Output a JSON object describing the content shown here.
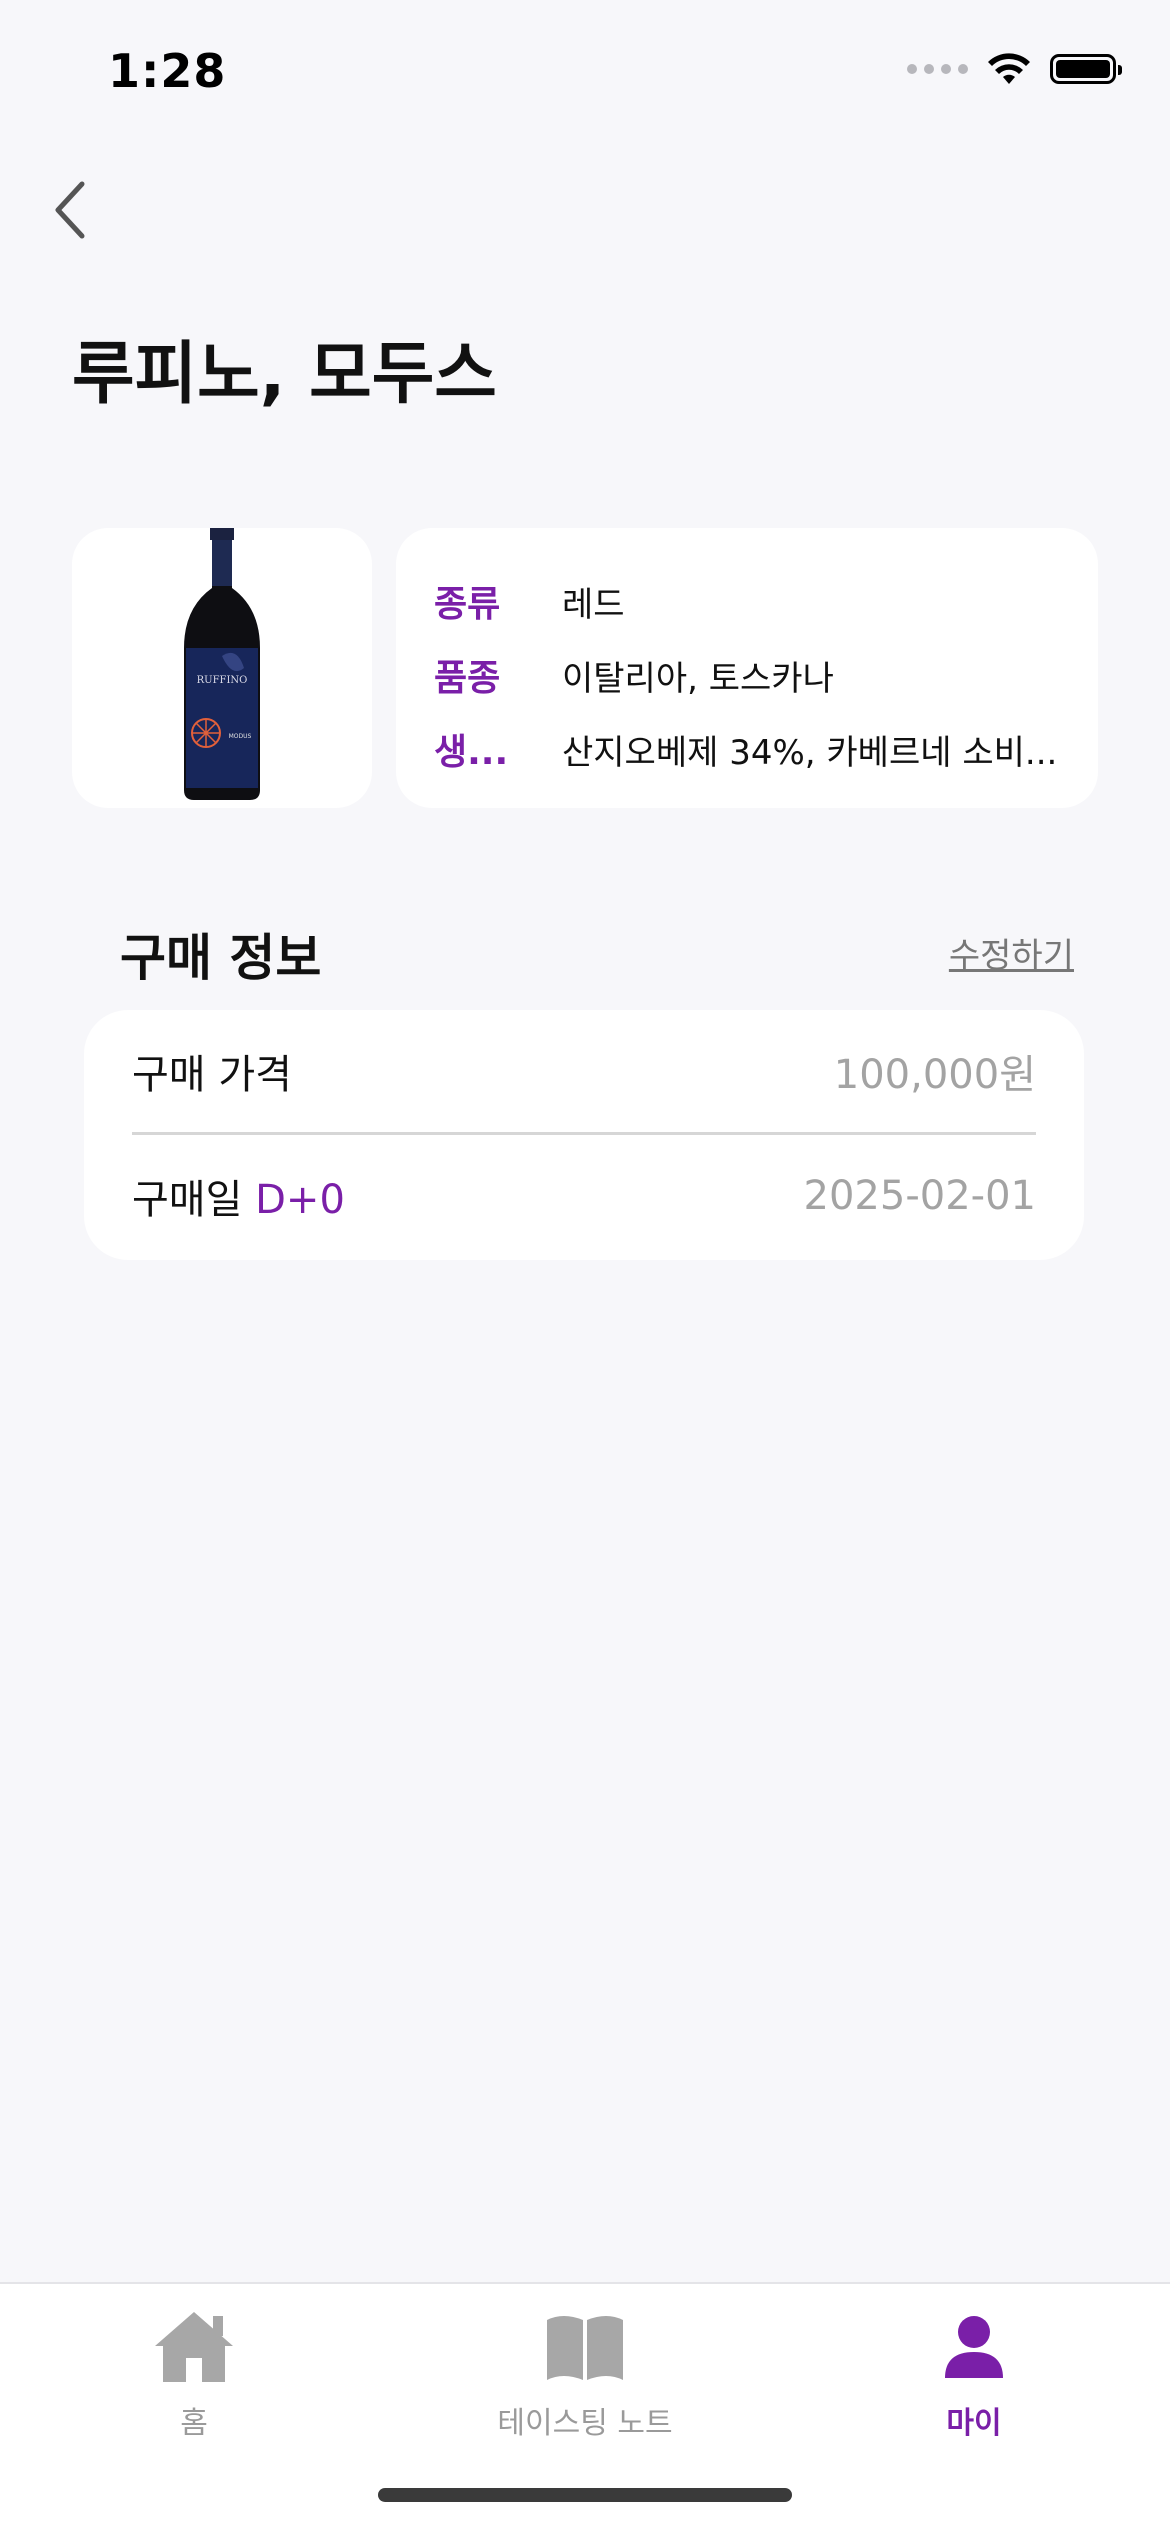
{
  "status_bar": {
    "time": "1:28"
  },
  "header": {
    "title": "루피노, 모두스"
  },
  "wine": {
    "image_alt": "wine bottle",
    "info": [
      {
        "label": "종류",
        "value": "레드"
      },
      {
        "label": "품종",
        "value": "이탈리아, 토스카나"
      },
      {
        "label": "생...",
        "value": "산지오베제 34%, 카베르네 소비..."
      }
    ]
  },
  "purchase": {
    "section_title": "구매 정보",
    "edit_label": "수정하기",
    "price_label": "구매 가격",
    "price_value": "100,000원",
    "date_label": "구매일",
    "dday": "D+0",
    "date_value": "2025-02-01"
  },
  "tabs": [
    {
      "label": "홈",
      "icon": "home-icon",
      "active": false
    },
    {
      "label": "테이스팅 노트",
      "icon": "book-icon",
      "active": false
    },
    {
      "label": "마이",
      "icon": "person-icon",
      "active": true
    }
  ],
  "colors": {
    "accent": "#7A1FA8",
    "background": "#F7F7FA",
    "muted": "#A3A3A3"
  }
}
